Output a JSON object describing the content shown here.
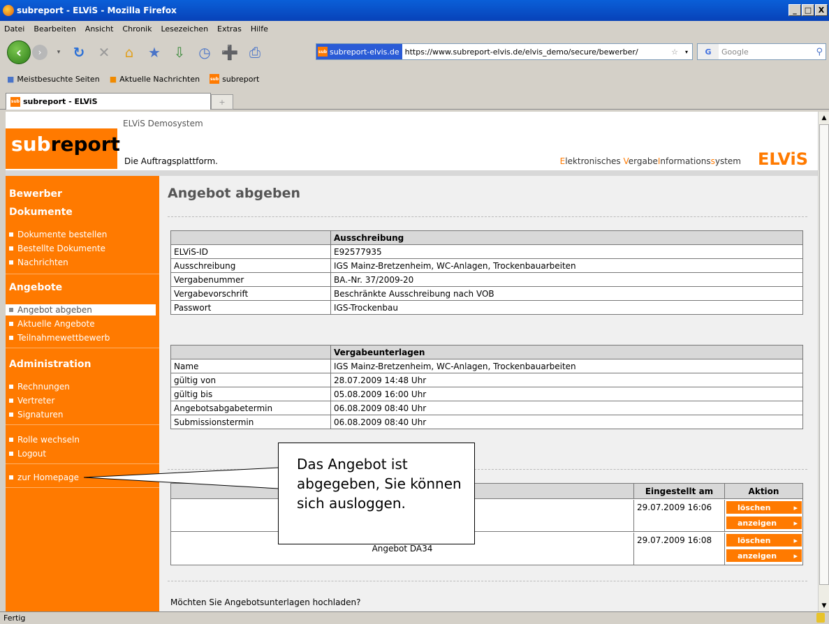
{
  "window": {
    "title": "subreport - ELViS - Mozilla Firefox",
    "min": "_",
    "max": "□",
    "close": "X"
  },
  "menu": [
    "Datei",
    "Bearbeiten",
    "Ansicht",
    "Chronik",
    "Lesezeichen",
    "Extras",
    "Hilfe"
  ],
  "nav": {
    "site": "subreport-elvis.de",
    "url": "https://www.subreport-elvis.de/elvis_demo/secure/bewerber/",
    "search_placeholder": "Google"
  },
  "bookmarks": [
    "Meistbesuchte Seiten",
    "Aktuelle Nachrichten",
    "subreport"
  ],
  "tab": {
    "title": "subreport - ELViS",
    "new": "+"
  },
  "status": "Fertig",
  "header": {
    "demo": "ELViS Demosystem",
    "logo_sub": "sub",
    "logo_report": "report",
    "tagline": "Die Auftragsplattform.",
    "elvis_full": [
      "E",
      "lektronisches ",
      "V",
      "ergabe",
      "I",
      "nformations",
      "s",
      "ystem"
    ],
    "elvis": "ELViS"
  },
  "sidebar": {
    "bewerber": "Bewerber",
    "dokumente": "Dokumente",
    "dok_items": [
      "Dokumente bestellen",
      "Bestellte Dokumente",
      "Nachrichten"
    ],
    "angebote": "Angebote",
    "ang_items": [
      "Angebot abgeben",
      "Aktuelle Angebote",
      "Teilnahmewettbewerb"
    ],
    "admin": "Administration",
    "admin_items": [
      "Rechnungen",
      "Vertreter",
      "Signaturen"
    ],
    "rolle": "Rolle wechseln",
    "logout": "Logout",
    "homepage": "zur Homepage"
  },
  "page": {
    "title": "Angebot abgeben",
    "question": "Möchten Sie Angebotsunterlagen hochladen?"
  },
  "ausschreibung": {
    "header": "Ausschreibung",
    "rows": [
      [
        "ELViS-ID",
        "E92577935"
      ],
      [
        "Ausschreibung",
        "IGS Mainz-Bretzenheim, WC-Anlagen, Trockenbauarbeiten"
      ],
      [
        "Vergabenummer",
        "BA.-Nr. 37/2009-20"
      ],
      [
        "Vergabevorschrift",
        "Beschränkte Ausschreibung nach VOB"
      ],
      [
        "Passwort",
        "IGS-Trockenbau"
      ]
    ]
  },
  "unterlagen": {
    "header": "Vergabeunterlagen",
    "rows": [
      [
        "Name",
        "IGS Mainz-Bretzenheim, WC-Anlagen, Trockenbauarbeiten"
      ],
      [
        "gültig von",
        "28.07.2009 14:48 Uhr"
      ],
      [
        "gültig bis",
        "05.08.2009 16:00 Uhr"
      ],
      [
        "Angebotsabgabetermin",
        "06.08.2009 08:40 Uhr"
      ],
      [
        "Submissionstermin",
        "06.08.2009 08:40 Uhr"
      ]
    ]
  },
  "angebote_table": {
    "col_date": "Eingestellt am",
    "col_action": "Aktion",
    "rows": [
      {
        "name": "",
        "date": "29.07.2009 16:06"
      },
      {
        "name": "Angebot DA34",
        "date": "29.07.2009 16:08"
      }
    ],
    "btn_delete": "löschen",
    "btn_show": "anzeigen"
  },
  "callout": "Das Angebot ist abgegeben, Sie können sich ausloggen."
}
